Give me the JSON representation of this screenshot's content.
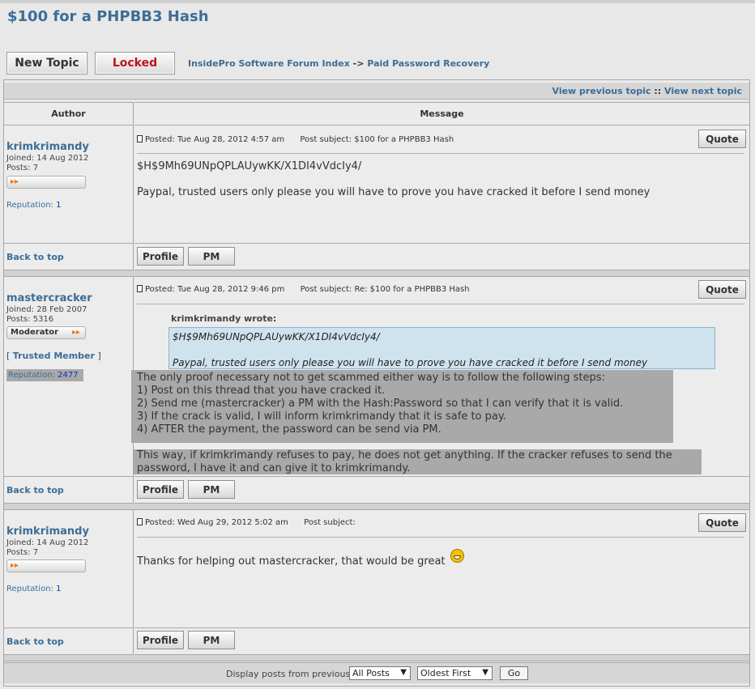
{
  "page_title": "$100 for a PHPBB3 Hash",
  "buttons": {
    "new_topic": "New Topic",
    "locked": "Locked"
  },
  "breadcrumb": {
    "index": "InsidePro Software Forum Index",
    "separator": "->",
    "forum": "Paid Password Recovery"
  },
  "topic_nav": {
    "prev": "View previous topic",
    "sep": "::",
    "next": "View next topic"
  },
  "table_headers": {
    "author": "Author",
    "message": "Message"
  },
  "labels": {
    "joined": "Joined:",
    "posts": "Posts:",
    "reputation": "Reputation:",
    "posted": "Posted:",
    "subject": "Post subject:",
    "quote": "Quote",
    "profile": "Profile",
    "pm": "PM",
    "back_to_top": "Back to top"
  },
  "posts": [
    {
      "author": "krimkrimandy",
      "joined": "14 Aug 2012",
      "posts": "7",
      "reputation": "1",
      "posted": "Tue Aug 28, 2012 4:57 am",
      "subject": "$100 for a PHPBB3 Hash",
      "body": [
        "$H$9Mh69UNpQPLAUywKK/X1DI4vVdcIy4/",
        "Paypal, trusted users only please you will have to prove you have cracked it before I send money"
      ]
    },
    {
      "author": "mastercracker",
      "joined": "28 Feb 2007",
      "posts": "5316",
      "reputation": "2477",
      "rank": "Moderator",
      "trusted": "Trusted Member",
      "posted": "Tue Aug 28, 2012 9:46 pm",
      "subject": "Re: $100 for a PHPBB3 Hash",
      "quote_author": "krimkrimandy wrote:",
      "quote_lines": [
        "$H$9Mh69UNpQPLAUywKK/X1DI4vVdcIy4/",
        "Paypal, trusted users only please you will have to prove you have cracked it before I send money"
      ],
      "body": [
        "The only proof necessary not to get scammed either way is to follow the following steps:",
        "1) Post on this thread that you have cracked it.",
        "2) Send me (mastercracker) a PM with the Hash:Password so that I can verify that it is valid.",
        "3) If the crack is valid, I will inform krimkrimandy that it is safe to pay.",
        "4) AFTER the payment, the password can be send via PM.",
        "This way, if krimkrimandy refuses to pay, he does not get anything. If the cracker refuses to send the",
        "password, I have it and can give it to krimkrimandy."
      ]
    },
    {
      "author": "krimkrimandy",
      "joined": "14 Aug 2012",
      "posts": "7",
      "reputation": "1",
      "posted": "Wed Aug 29, 2012 5:02 am",
      "subject": "",
      "body": [
        "Thanks for helping out mastercracker, that would be great"
      ]
    }
  ],
  "footer": {
    "label": "Display posts from previous:",
    "period": "All Posts",
    "order": "Oldest First",
    "go": "Go"
  },
  "icons": {
    "post": "post-icon",
    "smiley": "grin-smiley-icon",
    "rank_arrows": "rank-arrows-icon"
  }
}
